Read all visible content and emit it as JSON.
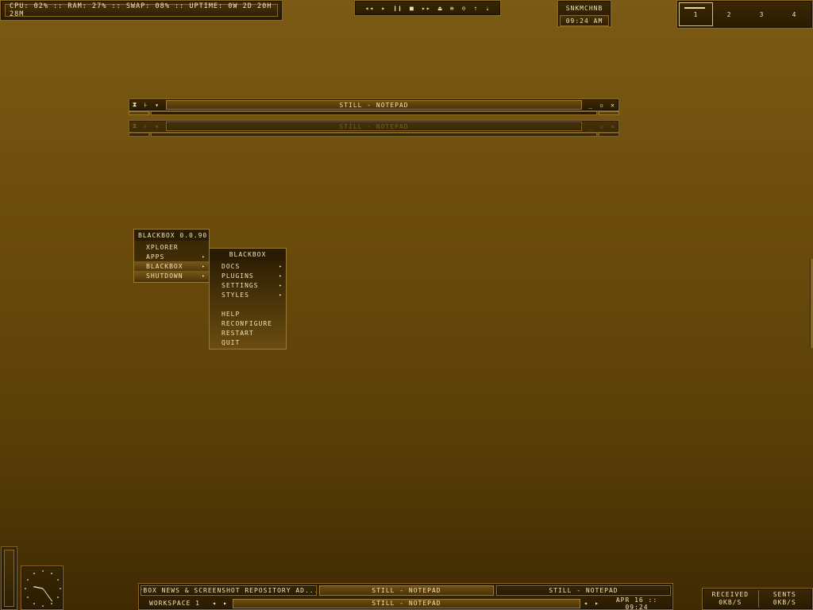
{
  "system": {
    "stats_text": "CPU: 02% :: RAM: 27% :: SWAP: 08% :: UPTIME: 0W 2D 20H 28M"
  },
  "media_controls": [
    {
      "name": "rewind-icon",
      "glyph": "◂◂"
    },
    {
      "name": "play-icon",
      "glyph": "▸"
    },
    {
      "name": "pause-icon",
      "glyph": "❙❙"
    },
    {
      "name": "stop-icon",
      "glyph": "■"
    },
    {
      "name": "fast-forward-icon",
      "glyph": "▸▸"
    },
    {
      "name": "eject-icon",
      "glyph": "⏏"
    },
    {
      "name": "playlist-icon",
      "glyph": "≡"
    },
    {
      "name": "repeat-icon",
      "glyph": "⊙"
    },
    {
      "name": "volume-up-icon",
      "glyph": "⇡"
    },
    {
      "name": "volume-down-icon",
      "glyph": "⇣"
    }
  ],
  "host": {
    "name": "SNKMCHNB",
    "time": "09:24 AM"
  },
  "pager": {
    "workspaces": [
      "1",
      "2",
      "3",
      "4"
    ],
    "active_index": 0
  },
  "windows": [
    {
      "title": "STILL - NOTEPAD",
      "state": "active"
    },
    {
      "title": "STILL - NOTEPAD",
      "state": "inactive"
    }
  ],
  "window_buttons": {
    "shade": "⧗",
    "stick": "⊦",
    "menu": "▾",
    "minimize": "_",
    "maximize": "▫",
    "close": "✕"
  },
  "root_menu": {
    "title": "BLACKBOX 0.0.90",
    "items": [
      {
        "label": "XPLORER",
        "submenu": false,
        "selected": false
      },
      {
        "label": "APPS",
        "submenu": true,
        "selected": false
      },
      {
        "label": "BLACKBOX",
        "submenu": true,
        "selected": true
      },
      {
        "label": "SHUTDOWN",
        "submenu": true,
        "selected": true
      }
    ]
  },
  "sub_menu": {
    "title": "BLACKBOX",
    "items": [
      {
        "label": "DOCS",
        "submenu": true
      },
      {
        "label": "PLUGINS",
        "submenu": true
      },
      {
        "label": "SETTINGS",
        "submenu": true
      },
      {
        "label": "STYLES",
        "submenu": true
      },
      {
        "label": "",
        "separator": true
      },
      {
        "label": "HELP",
        "submenu": false
      },
      {
        "label": "RECONFIGURE",
        "submenu": false
      },
      {
        "label": "RESTART",
        "submenu": false
      },
      {
        "label": "QUIT",
        "submenu": false
      }
    ]
  },
  "taskbar": {
    "tasks": [
      "*BOX NEWS & SCREENSHOT REPOSITORY AD...",
      "STILL - NOTEPAD",
      "STILL - NOTEPAD"
    ],
    "workspace_label": "WORKSPACE 1",
    "current_window": "STILL - NOTEPAD",
    "datetime": "APR 16 :: 09:24",
    "prev_glyph": "◂",
    "next_glyph": "▸"
  },
  "network": {
    "received_label": "RECEIVED",
    "received_value": "0KB/S",
    "sent_label": "SENTS",
    "sent_value": "0KB/S"
  },
  "clock": {
    "hour": 9,
    "minute": 24
  },
  "colors": {
    "accent": "#9a7a30",
    "text": "#f2e2b4",
    "panel": "#2a1c02",
    "desktop_top": "#7a5a14",
    "desktop_bottom": "#3f2a03"
  }
}
